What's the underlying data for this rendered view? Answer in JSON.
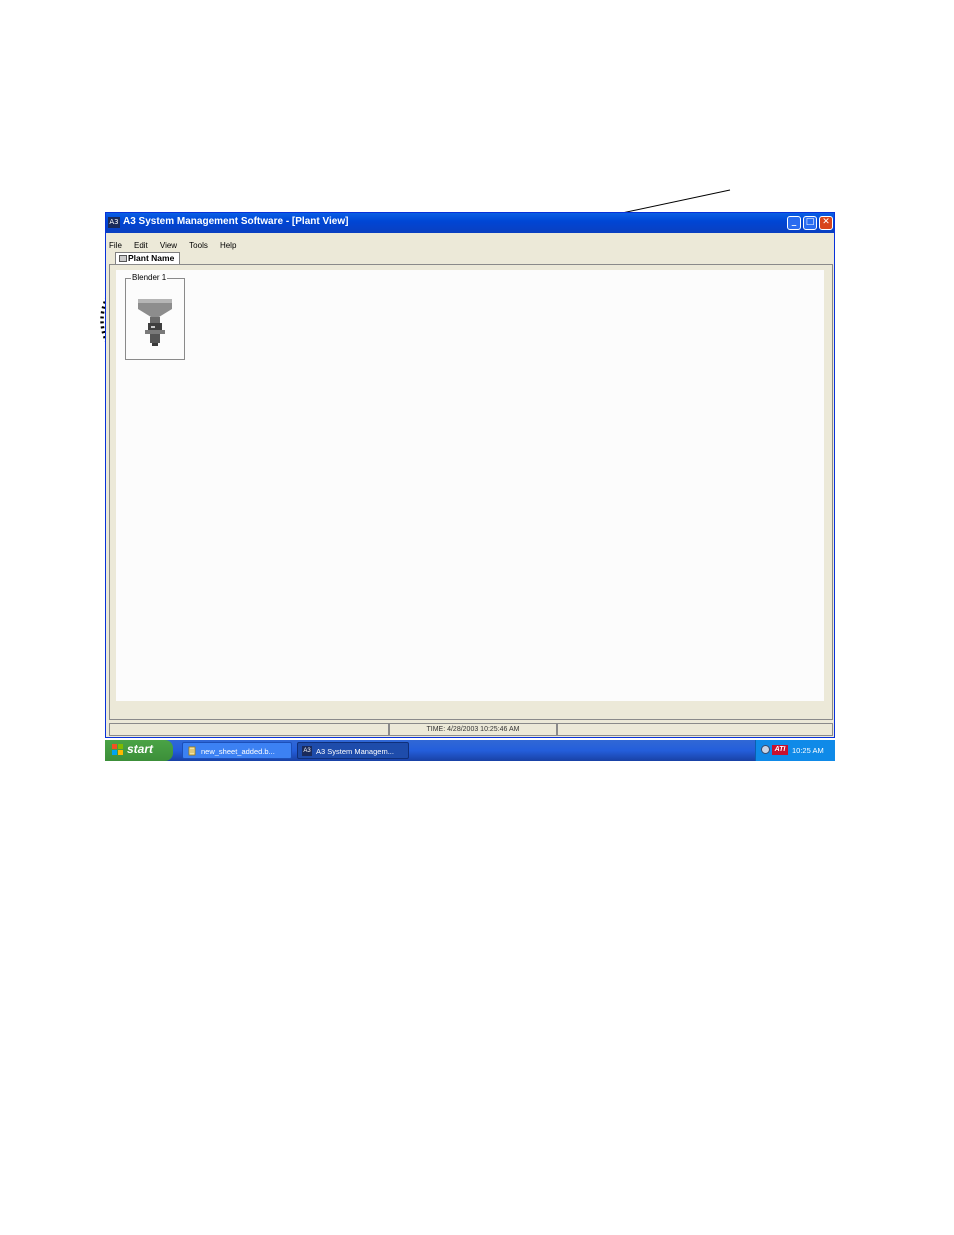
{
  "window": {
    "icon_text": "A3",
    "title": "A3 System Management Software - [Plant View]"
  },
  "menu": [
    "File",
    "Edit",
    "View",
    "Tools",
    "Help"
  ],
  "tab": {
    "label": "Plant Name"
  },
  "device": {
    "label": "Blender 1"
  },
  "status": {
    "time": "TIME:  4/28/2003 10:25:46 AM"
  },
  "taskbar": {
    "start_label": "start",
    "tasks": [
      {
        "label": "new_sheet_added.b..."
      },
      {
        "icon_text": "A3",
        "label": "A3 System Managem..."
      }
    ],
    "tray_logo": "ATI",
    "clock": "10:25 AM"
  }
}
